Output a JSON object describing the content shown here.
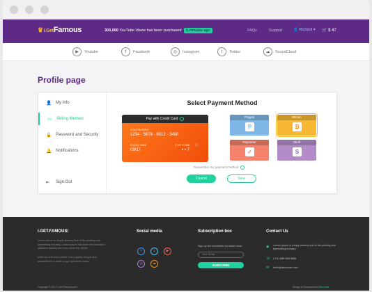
{
  "topbar": {
    "logo_prefix": "I.Get",
    "logo_main": "Famous",
    "notice_count": "300,000",
    "notice_text": "YouTube Views has been purchased",
    "notice_time": "5 minutes ago",
    "faqs": "FAQs",
    "support": "Support",
    "user": "Richard",
    "cart_value": "$ 47"
  },
  "social": [
    "Youtube",
    "Facebook",
    "Instagram",
    "Twitter",
    "SoundCloud"
  ],
  "page_title": "Profile page",
  "sidebar": {
    "items": [
      {
        "label": "My Info",
        "icon": "user-icon"
      },
      {
        "label": "Billing Method",
        "icon": "credit-card-icon"
      },
      {
        "label": "Password and Security",
        "icon": "lock-icon"
      },
      {
        "label": "Notifications",
        "icon": "bell-icon"
      }
    ],
    "sign_out": "Sign Out"
  },
  "payment": {
    "title": "Select Payment Method",
    "card": {
      "header": "Pay with Credit Card",
      "number_label": "Card Number",
      "number": "1234 - 5678 - 9012 - 3450",
      "expiry_label": "Expiry Date",
      "expiry": "09/17",
      "cvc_label": "CVC Code",
      "cvc": "• • 7"
    },
    "methods": [
      {
        "name": "Paypal",
        "glyph": "P",
        "color": "#7eb6e8"
      },
      {
        "name": "Bitcoin",
        "glyph": "₿",
        "color": "#f7b733"
      },
      {
        "name": "Payoneer",
        "glyph": "✓",
        "color": "#f4826c"
      },
      {
        "name": "Skrill",
        "glyph": "S",
        "color": "#b48bc9"
      }
    ],
    "remember": "Remember my payment method",
    "cancel": "Cancel",
    "save": "Save"
  },
  "footer": {
    "brand": "I.GET.FAMOUS!",
    "about1": "Lorem Ipsum is simply dummy text of the printing and typesetting industry. Lorem Ipsum has been the industry's standard dummy text ever since the 1500s,",
    "about2": "when an unknown printer took a galley of type and scrambled it to make a type specimen book.",
    "social_title": "Social media",
    "sub_title": "Subscription box",
    "sub_text": "Sign up the newsletter for latest news",
    "sub_placeholder": "Your Email",
    "sub_button": "SUBSCRIBE",
    "contact_title": "Contact Us",
    "address": "Lorem Ipsum is simply dummy text of the printing and typesetting industry",
    "phone": "(+01) 888 888 8888",
    "email": "hello@delucode.com",
    "copyright": "Copyright © 2017 I.Get.Famous.com",
    "credit_label": "Design & Development",
    "credit_name": "DeluCode"
  }
}
